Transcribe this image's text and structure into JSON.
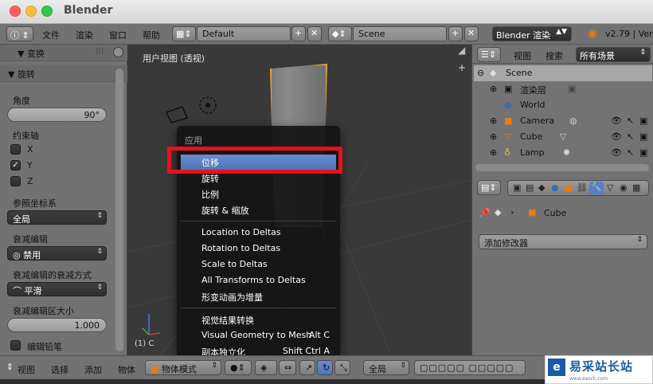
{
  "window": {
    "app_title": "Blender"
  },
  "info_header": {
    "menus": [
      "文件",
      "渲染",
      "窗口",
      "帮助"
    ],
    "layout": "Default",
    "scene": "Scene",
    "engine": "Blender 渲染",
    "version": "v2.79 | Ver"
  },
  "left_panel": {
    "section_title": "▼ 变换",
    "operator_title": "▼ 旋转",
    "angle_label": "角度",
    "angle_value": "90°",
    "constraint_label": "约束轴",
    "axes": [
      {
        "label": "X",
        "checked": false
      },
      {
        "label": "Y",
        "checked": true
      },
      {
        "label": "Z",
        "checked": false
      }
    ],
    "orientation_label": "参照坐标系",
    "orientation_value": "全局",
    "proportional_label": "衰减编辑",
    "proportional_value": "禁用",
    "falloff_label": "衰减编辑的衰减方式",
    "falloff_value": "平滑",
    "size_label": "衰减编辑区大小",
    "size_value": "1.000",
    "edit_grease_label": "编辑铅笔"
  },
  "viewport": {
    "title": "用户视图 (透视)",
    "corner_text": "(1) C"
  },
  "apply_menu": {
    "title": "应用",
    "items": [
      {
        "label": "位移",
        "shortcut": "",
        "selected": true
      },
      {
        "label": "旋转",
        "shortcut": "",
        "selected": false
      },
      {
        "label": "比例",
        "shortcut": "",
        "selected": false
      },
      {
        "label": "旋转 & 缩放",
        "shortcut": "",
        "selected": false
      },
      {
        "label": "Location to Deltas",
        "shortcut": "",
        "selected": false
      },
      {
        "label": "Rotation to Deltas",
        "shortcut": "",
        "selected": false
      },
      {
        "label": "Scale to Deltas",
        "shortcut": "",
        "selected": false
      },
      {
        "label": "All Transforms to Deltas",
        "shortcut": "",
        "selected": false
      },
      {
        "label": "形变动画为增量",
        "shortcut": "",
        "selected": false
      },
      {
        "label": "视觉结果转换",
        "shortcut": "",
        "selected": false
      },
      {
        "label": "Visual Geometry to Mesh",
        "shortcut": "Alt C",
        "selected": false
      },
      {
        "label": "副本独立化",
        "shortcut": "Shift Ctrl A",
        "selected": false
      }
    ]
  },
  "outliner": {
    "header_view": "视图",
    "header_search": "搜索",
    "header_filter": "所有场景",
    "rows": [
      {
        "label": "Scene"
      },
      {
        "label": "渲染层"
      },
      {
        "label": "World"
      },
      {
        "label": "Camera"
      },
      {
        "label": "Cube"
      },
      {
        "label": "Lamp"
      }
    ]
  },
  "properties": {
    "object_name": "Cube",
    "add_modifier": "添加修改器"
  },
  "bottom_header": {
    "menus": [
      "视图",
      "选择",
      "添加",
      "物体"
    ],
    "mode": "物体模式",
    "orientation": "全局"
  },
  "watermark": {
    "logo": "e",
    "title": "易采站长站",
    "subtitle": "www.easck.com"
  },
  "colors": {
    "highlight_box": "#e8111b",
    "selected_item": "#5a7fc4",
    "selection_outline": "#e3a43a"
  }
}
